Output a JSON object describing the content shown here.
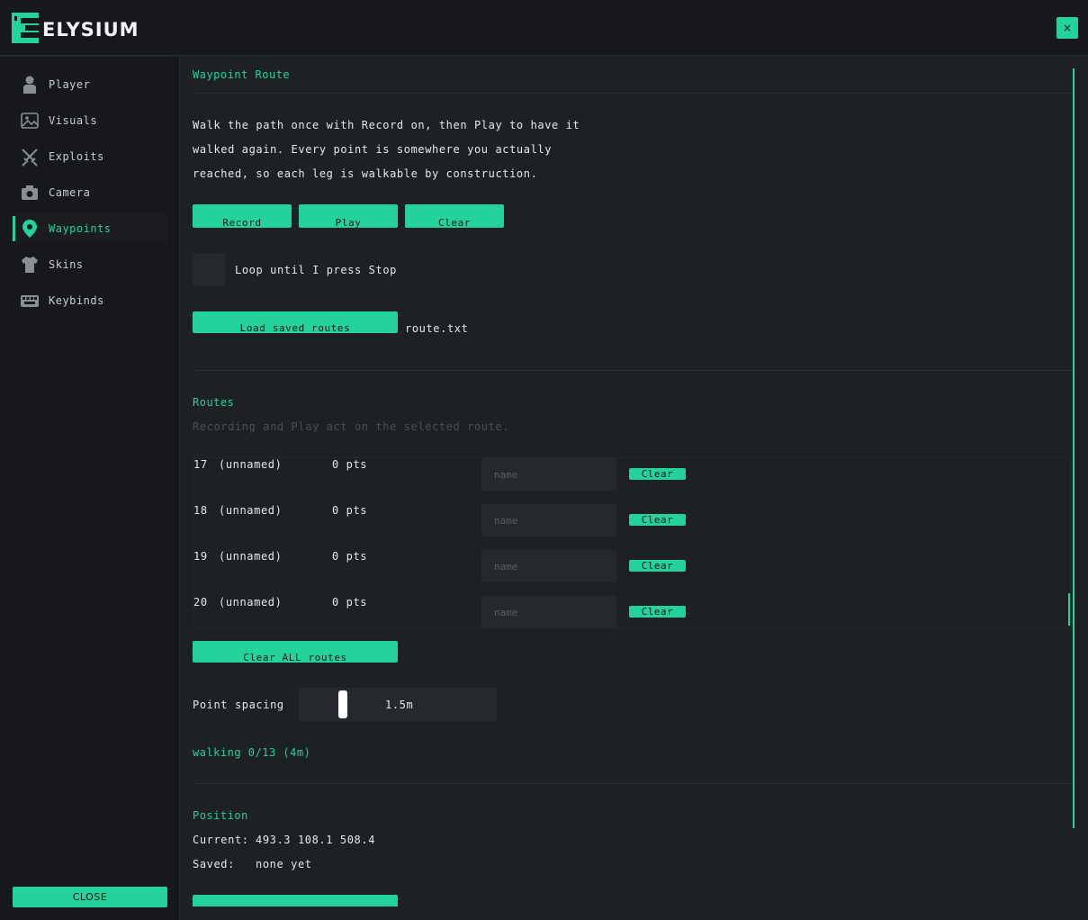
{
  "app": {
    "title": "ELYSIUM",
    "close_icon": "×"
  },
  "sidebar": {
    "items": [
      {
        "label": "Player",
        "icon": "player-icon"
      },
      {
        "label": "Visuals",
        "icon": "image-icon"
      },
      {
        "label": "Exploits",
        "icon": "swords-icon"
      },
      {
        "label": "Camera",
        "icon": "camera-icon"
      },
      {
        "label": "Waypoints",
        "icon": "map-pin-icon",
        "active": true
      },
      {
        "label": "Skins",
        "icon": "shirt-icon"
      },
      {
        "label": "Keybinds",
        "icon": "keyboard-icon"
      }
    ],
    "close_label": "CLOSE"
  },
  "waypoint_route": {
    "title": "Waypoint Route",
    "description": [
      "Walk the path once with Record on, then Play to have it",
      "walked again. Every point is somewhere you actually",
      "reached, so each leg is walkable by construction."
    ],
    "record_label": "Record",
    "play_label": "Play",
    "clear_label": "Clear",
    "loop_label": "Loop until I press Stop",
    "loop_checked": false,
    "load_label": "Load saved routes",
    "filename": "route.txt"
  },
  "routes": {
    "title": "Routes",
    "subtitle": "Recording and Play act on the selected route.",
    "name_placeholder": "name",
    "clear_label": "Clear",
    "items": [
      {
        "num": "17",
        "name": "(unnamed)",
        "pts": "0 pts"
      },
      {
        "num": "18",
        "name": "(unnamed)",
        "pts": "0 pts"
      },
      {
        "num": "19",
        "name": "(unnamed)",
        "pts": "0 pts"
      },
      {
        "num": "20",
        "name": "(unnamed)",
        "pts": "0 pts"
      }
    ],
    "clear_all_label": "Clear ALL routes",
    "spacing_label": "Point spacing",
    "spacing_value": "1.5m",
    "spacing_fraction": 0.2,
    "status": "walking 0/13  (4m)"
  },
  "position": {
    "title": "Position",
    "current_label": "Current:",
    "current_value": "493.3  108.1  508.4",
    "saved_label": "Saved:",
    "saved_value": "none yet"
  },
  "colors": {
    "accent": "#23d39b",
    "background": "#1d2024",
    "panel": "#16181c",
    "input": "#25282d"
  }
}
